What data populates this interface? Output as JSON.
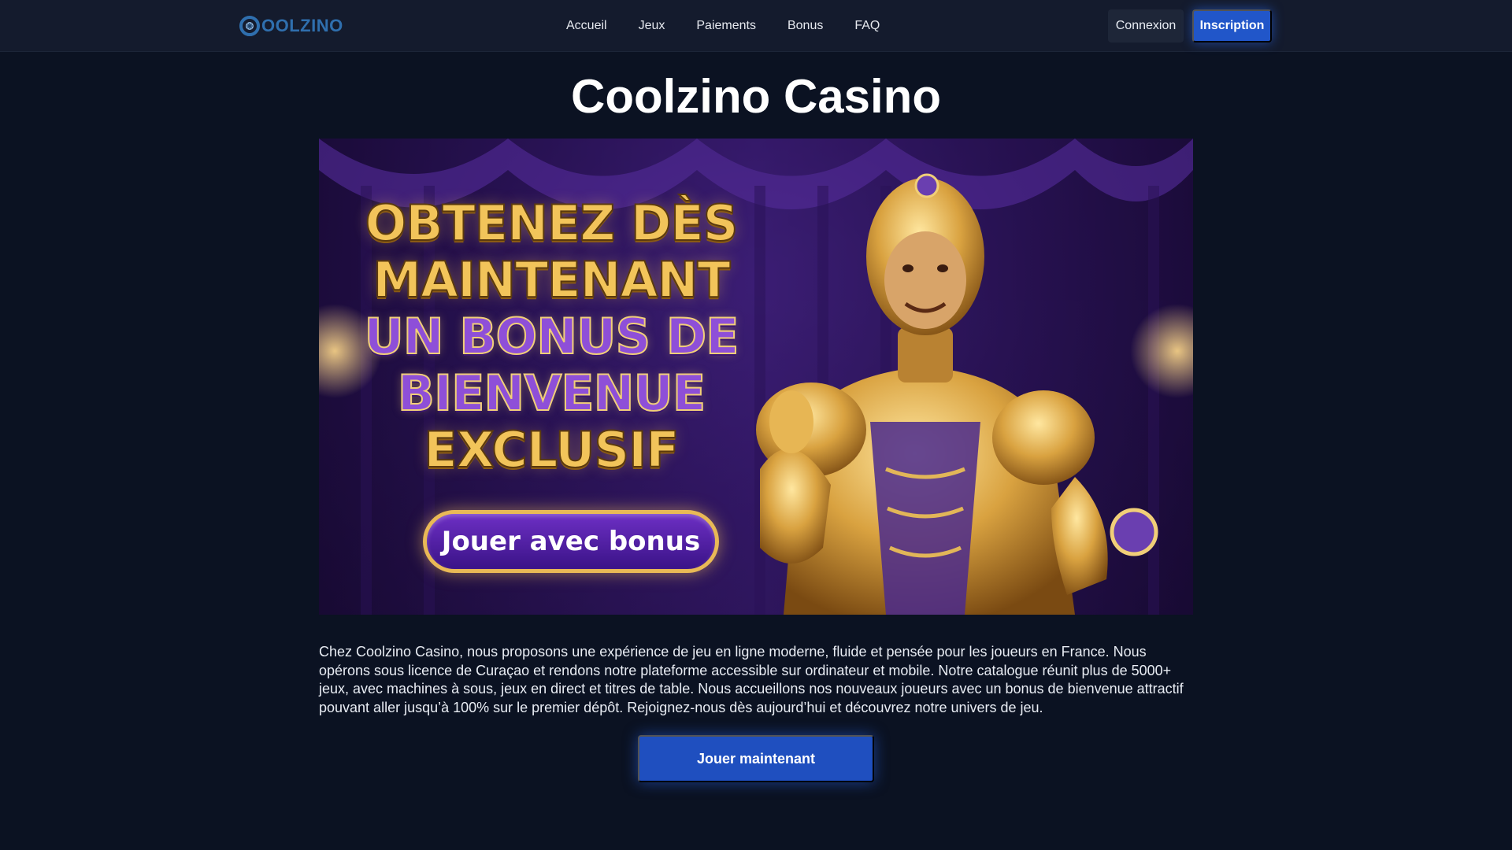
{
  "brand": {
    "logo_text": "OOLZINO",
    "accent": "#2f6fae"
  },
  "nav": {
    "items": [
      "Accueil",
      "Jeux",
      "Paiements",
      "Bonus",
      "FAQ"
    ]
  },
  "auth": {
    "login_label": "Connexion",
    "signup_label": "Inscription"
  },
  "main": {
    "title": "Coolzino Casino",
    "banner": {
      "lines": [
        "OBTENEZ DÈS",
        "MAINTENANT",
        "UN BONUS DE",
        "BIENVENUE",
        "EXCLUSIF"
      ],
      "cta": "Jouer avec bonus"
    },
    "intro": "Chez Coolzino Casino, nous proposons une expérience de jeu en ligne moderne, fluide et pensée pour les joueurs en France. Nous opérons sous licence de Curaçao et rendons notre plateforme accessible sur ordinateur et mobile. Notre catalogue réunit plus de 5000+ jeux, avec machines à sous, jeux en direct et titres de table. Nous accueillons nos nouveaux joueurs avec un bonus de bienvenue attractif pouvant aller jusqu’à 100% sur le premier dépôt. Rejoignez-nous dès aujourd’hui et découvrez notre univers de jeu.",
    "cta": "Jouer maintenant"
  },
  "colors": {
    "background": "#0b1222",
    "header": "#141b2d",
    "primary_button": "#2156c9",
    "gold": "#f2c45a",
    "purple": "#8e4fd8"
  },
  "icons": {
    "logo_mark": "snowflake-coin-icon",
    "banner_character": "gold-robot-illustration"
  }
}
